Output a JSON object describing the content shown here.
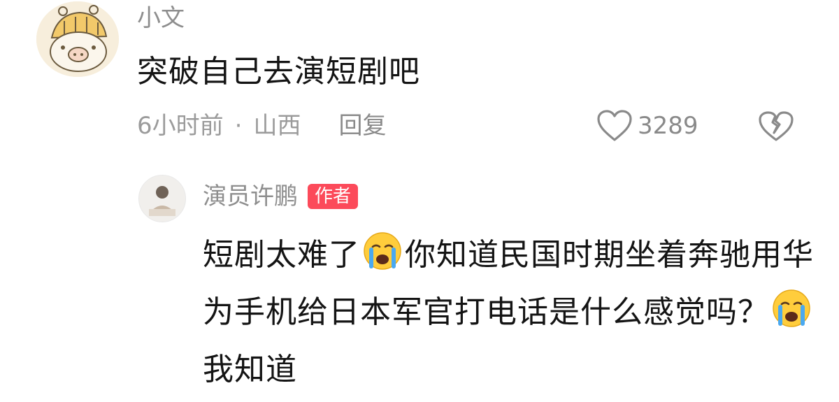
{
  "comment": {
    "username": "小文",
    "text": "突破自己去演短剧吧",
    "time": "6小时前",
    "separator": "·",
    "location": "山西",
    "reply_label": "回复",
    "like_count": "3289"
  },
  "reply": {
    "username": "演员许鹏",
    "badge": "作者",
    "text_part1": "短剧太难了",
    "text_part2": "你知道民国时期坐着奔驰用华为手机给日本军官打电话是什么感觉吗？",
    "text_part3": "我知道",
    "emoji": "crying-face-icon"
  },
  "colors": {
    "badge": "#fc4a5a",
    "meta_text": "#9b9b9b",
    "body_text": "#141414"
  }
}
